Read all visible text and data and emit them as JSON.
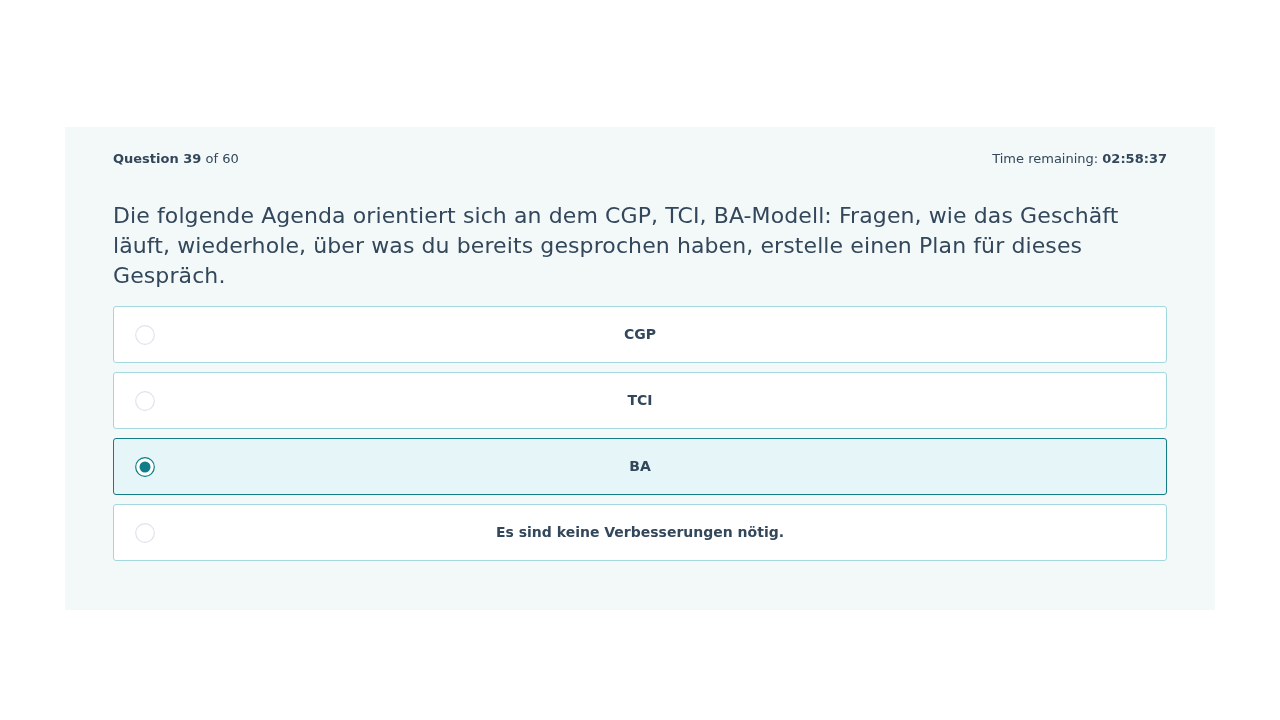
{
  "quiz": {
    "progress": "**Question 39** of 60",
    "timer": "Time remaining: **02:58:37**",
    "question": "Die folgende Agenda orientiert sich an dem CGP, TCI, BA-Modell: Fragen, wie das Geschäft läuft, wiederhole, über was du bereits gesprochen haben, erstelle einen Plan für dieses Gespräch.",
    "options": [
      {
        "label": "CGP",
        "selected": false
      },
      {
        "label": "TCI",
        "selected": false
      },
      {
        "label": "BA",
        "selected": true
      },
      {
        "label": "Es sind keine Verbesserungen nötig.",
        "selected": false
      }
    ]
  }
}
